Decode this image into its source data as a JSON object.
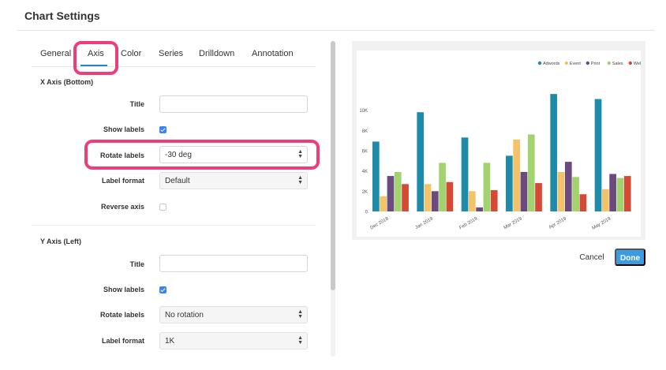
{
  "dialog": {
    "title": "Chart Settings"
  },
  "tabs": [
    {
      "label": "General"
    },
    {
      "label": "Axis"
    },
    {
      "label": "Color"
    },
    {
      "label": "Series"
    },
    {
      "label": "Drilldown"
    },
    {
      "label": "Annotation"
    }
  ],
  "active_tab": "Axis",
  "x_axis": {
    "section_title": "X Axis (Bottom)",
    "title_label": "Title",
    "title_value": "",
    "show_labels_label": "Show labels",
    "show_labels": true,
    "rotate_labels_label": "Rotate labels",
    "rotate_labels_value": "-30 deg",
    "label_format_label": "Label format",
    "label_format_value": "Default",
    "reverse_axis_label": "Reverse axis",
    "reverse_axis": false
  },
  "y_axis": {
    "section_title": "Y Axis (Left)",
    "title_label": "Title",
    "title_value": "",
    "show_labels_label": "Show labels",
    "show_labels": true,
    "rotate_labels_label": "Rotate labels",
    "rotate_labels_value": "No rotation",
    "label_format_label": "Label format",
    "label_format_value": "1K"
  },
  "buttons": {
    "cancel": "Cancel",
    "done": "Done"
  },
  "colors": {
    "highlight": "#ee3e7a",
    "accent": "#3d9be0",
    "tab_underline": "#1e88c8"
  },
  "chart_data": {
    "type": "bar",
    "categories": [
      "Dec 2018",
      "Jan 2019",
      "Feb 2019",
      "Mar 2019",
      "Apr 2019",
      "May 2019"
    ],
    "series": [
      {
        "name": "Adwords",
        "color": "#1f8bab",
        "values": [
          6900,
          9800,
          7300,
          5500,
          11600,
          11100
        ]
      },
      {
        "name": "Event",
        "color": "#f3c36a",
        "values": [
          1500,
          2700,
          2000,
          7100,
          3900,
          2200
        ]
      },
      {
        "name": "Print",
        "color": "#6b4a7e",
        "values": [
          3500,
          2000,
          400,
          3900,
          4900,
          3700
        ]
      },
      {
        "name": "Sales",
        "color": "#a3d36e",
        "values": [
          3900,
          4800,
          4800,
          7600,
          3400,
          3300
        ]
      },
      {
        "name": "Web",
        "color": "#d44a35",
        "values": [
          2700,
          2900,
          2100,
          2800,
          1700,
          3500
        ]
      }
    ],
    "y_ticks": [
      "0",
      "2K",
      "4K",
      "6K",
      "8K",
      "10K"
    ],
    "ylim": [
      0,
      12000
    ],
    "legend": "top-right",
    "x_label_rotation": -30
  }
}
